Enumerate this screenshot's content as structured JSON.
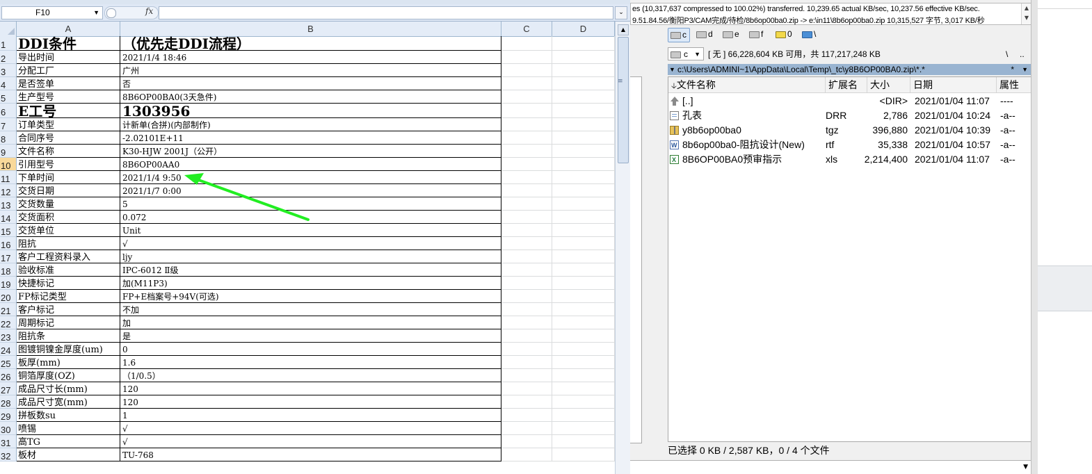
{
  "excel": {
    "name_box": "F10",
    "fx_label": "fx",
    "columns": [
      "A",
      "B",
      "C",
      "D"
    ],
    "rows": [
      {
        "n": "1",
        "a": "DDI条件",
        "b": "（优先走DDI流程）"
      },
      {
        "n": "2",
        "a": "导出时间",
        "b": "2021/1/4 18:46"
      },
      {
        "n": "3",
        "a": "分配工厂",
        "b": "广州"
      },
      {
        "n": "4",
        "a": "是否签单",
        "b": "否"
      },
      {
        "n": "5",
        "a": "生产型号",
        "b": "8B6OP00BA0(3天急件)"
      },
      {
        "n": "6",
        "a": "E工号",
        "b": "1303956"
      },
      {
        "n": "7",
        "a": "订单类型",
        "b": "计新单(合拼)(内部制作)"
      },
      {
        "n": "8",
        "a": "合同序号",
        "b": "-2.02101E+11"
      },
      {
        "n": "9",
        "a": "文件名称",
        "b": "K30-HJW 2001J（公开）"
      },
      {
        "n": "10",
        "a": "引用型号",
        "b": "8B6OP00AA0"
      },
      {
        "n": "11",
        "a": "下单时间",
        "b": "2021/1/4 9:50"
      },
      {
        "n": "12",
        "a": "交货日期",
        "b": "2021/1/7 0:00"
      },
      {
        "n": "13",
        "a": "交货数量",
        "b": "5"
      },
      {
        "n": "14",
        "a": "交货面积",
        "b": "0.072"
      },
      {
        "n": "15",
        "a": "交货单位",
        "b": "Unit"
      },
      {
        "n": "16",
        "a": "阻抗",
        "b": "√"
      },
      {
        "n": "17",
        "a": "客户工程资料录入",
        "b": "ljy"
      },
      {
        "n": "18",
        "a": "验收标准",
        "b": "IPC-6012 Ⅱ级"
      },
      {
        "n": "19",
        "a": "快捷标记",
        "b": "加(M11P3)"
      },
      {
        "n": "20",
        "a": "FP标记类型",
        "b": "FP+E档案号+94V(可选)"
      },
      {
        "n": "21",
        "a": "客户标记",
        "b": "不加"
      },
      {
        "n": "22",
        "a": "周期标记",
        "b": "加"
      },
      {
        "n": "23",
        "a": "阻抗条",
        "b": "是"
      },
      {
        "n": "24",
        "a": "图镀铜镍金厚度(um)",
        "b": "0"
      },
      {
        "n": "25",
        "a": "板厚(mm)",
        "b": "1.6"
      },
      {
        "n": "26",
        "a": "铜箔厚度(OZ)",
        "b": "（1/0.5）"
      },
      {
        "n": "27",
        "a": "成品尺寸长(mm)",
        "b": "120"
      },
      {
        "n": "28",
        "a": "成品尺寸宽(mm)",
        "b": "120"
      },
      {
        "n": "29",
        "a": "拼板数su",
        "b": "1"
      },
      {
        "n": "30",
        "a": "喷锡",
        "b": "√"
      },
      {
        "n": "31",
        "a": "高TG",
        "b": "√"
      },
      {
        "n": "32",
        "a": "板材",
        "b": "TU-768"
      }
    ]
  },
  "tc": {
    "log_lines": [
      "es (10,317,637 compressed to 100.02%) transferred. 10,239.65 actual KB/sec, 10,237.56 effective KB/sec.",
      "9.51.84.56/衡阳P3/CAM完成/待检/8b6op00ba0.zip -> e:\\in11\\8b6op00ba0.zip 10,315,527 字节, 3,017 KB/秒"
    ],
    "drives": [
      "c",
      "d",
      "e",
      "f",
      "0",
      "\\"
    ],
    "current_drive": "c",
    "free_space": "[ 无 ]  66,228,604 KB 可用，共 117,217,248 KB",
    "root_btn": "\\",
    "up_btn": "..",
    "path": "c:\\Users\\ADMINI~1\\AppData\\Local\\Temp\\_tc\\y8B6OP00BA0.zip\\*.*",
    "path_star": "*",
    "headers": {
      "name": "文件名称",
      "ext": "扩展名",
      "size": "大小",
      "date": "日期",
      "attr": "属性"
    },
    "files": [
      {
        "name": "[..]",
        "ext": "",
        "size": "<DIR>",
        "date": "2021/01/04 11:07",
        "attr": "----",
        "icon": "up-icon"
      },
      {
        "name": "孔表",
        "ext": "DRR",
        "size": "2,786",
        "date": "2021/01/04 10:24",
        "attr": "-a--",
        "icon": "file-icon"
      },
      {
        "name": "y8b6op00ba0",
        "ext": "tgz",
        "size": "396,880",
        "date": "2021/01/04 10:39",
        "attr": "-a--",
        "icon": "archive-icon"
      },
      {
        "name": "8b6op00ba0-阻抗设计(New)",
        "ext": "rtf",
        "size": "35,338",
        "date": "2021/01/04 10:57",
        "attr": "-a--",
        "icon": "word-doc-icon"
      },
      {
        "name": "8B6OP00BA0预审指示",
        "ext": "xls",
        "size": "2,214,400",
        "date": "2021/01/04 11:07",
        "attr": "-a--",
        "icon": "excel-doc-icon"
      }
    ],
    "status": "已选择 0 KB / 2,587 KB，0 / 4 个文件"
  },
  "colors": {
    "arrow": "#22ee22",
    "path_bar": "#99b4d1",
    "selected_row_header": "#f9d99a"
  }
}
